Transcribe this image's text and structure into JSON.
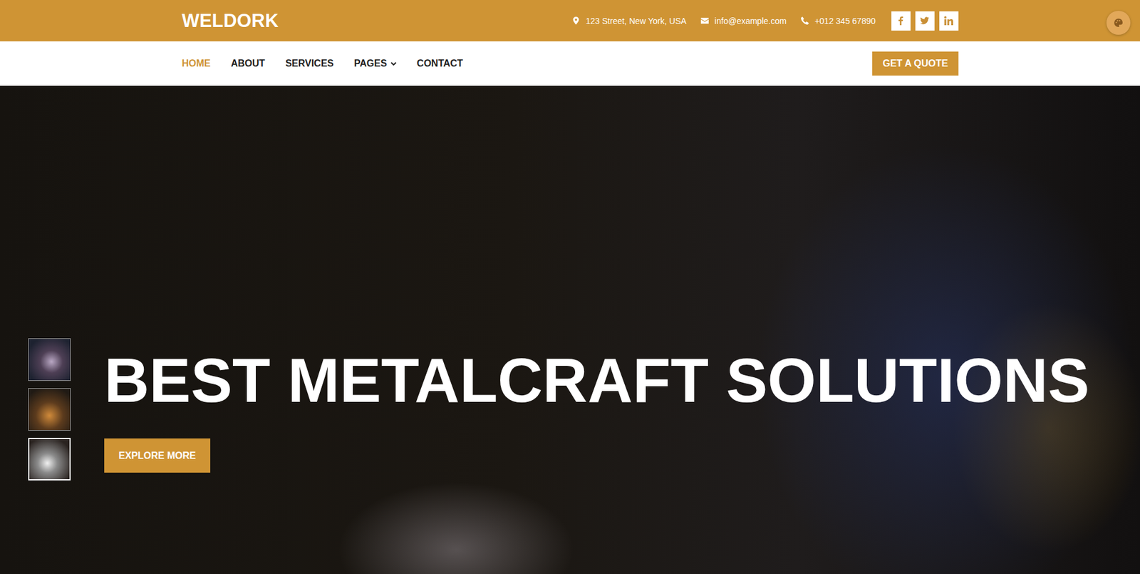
{
  "brand": "WELDORK",
  "topbar": {
    "address": "123 Street, New York, USA",
    "email": "info@example.com",
    "phone": "+012 345 67890"
  },
  "nav": [
    {
      "label": "HOME",
      "selected": true,
      "dropdown": false
    },
    {
      "label": "ABOUT",
      "selected": false,
      "dropdown": false
    },
    {
      "label": "SERVICES",
      "selected": false,
      "dropdown": false
    },
    {
      "label": "PAGES",
      "selected": false,
      "dropdown": true
    },
    {
      "label": "CONTACT",
      "selected": false,
      "dropdown": false
    }
  ],
  "quote_button": "GET A QUOTE",
  "hero": {
    "title": "BEST METALCRAFT SOLUTIONS",
    "button": "EXPLORE MORE",
    "thumbnails": [
      {
        "selected": false
      },
      {
        "selected": false
      },
      {
        "selected": true
      }
    ]
  }
}
